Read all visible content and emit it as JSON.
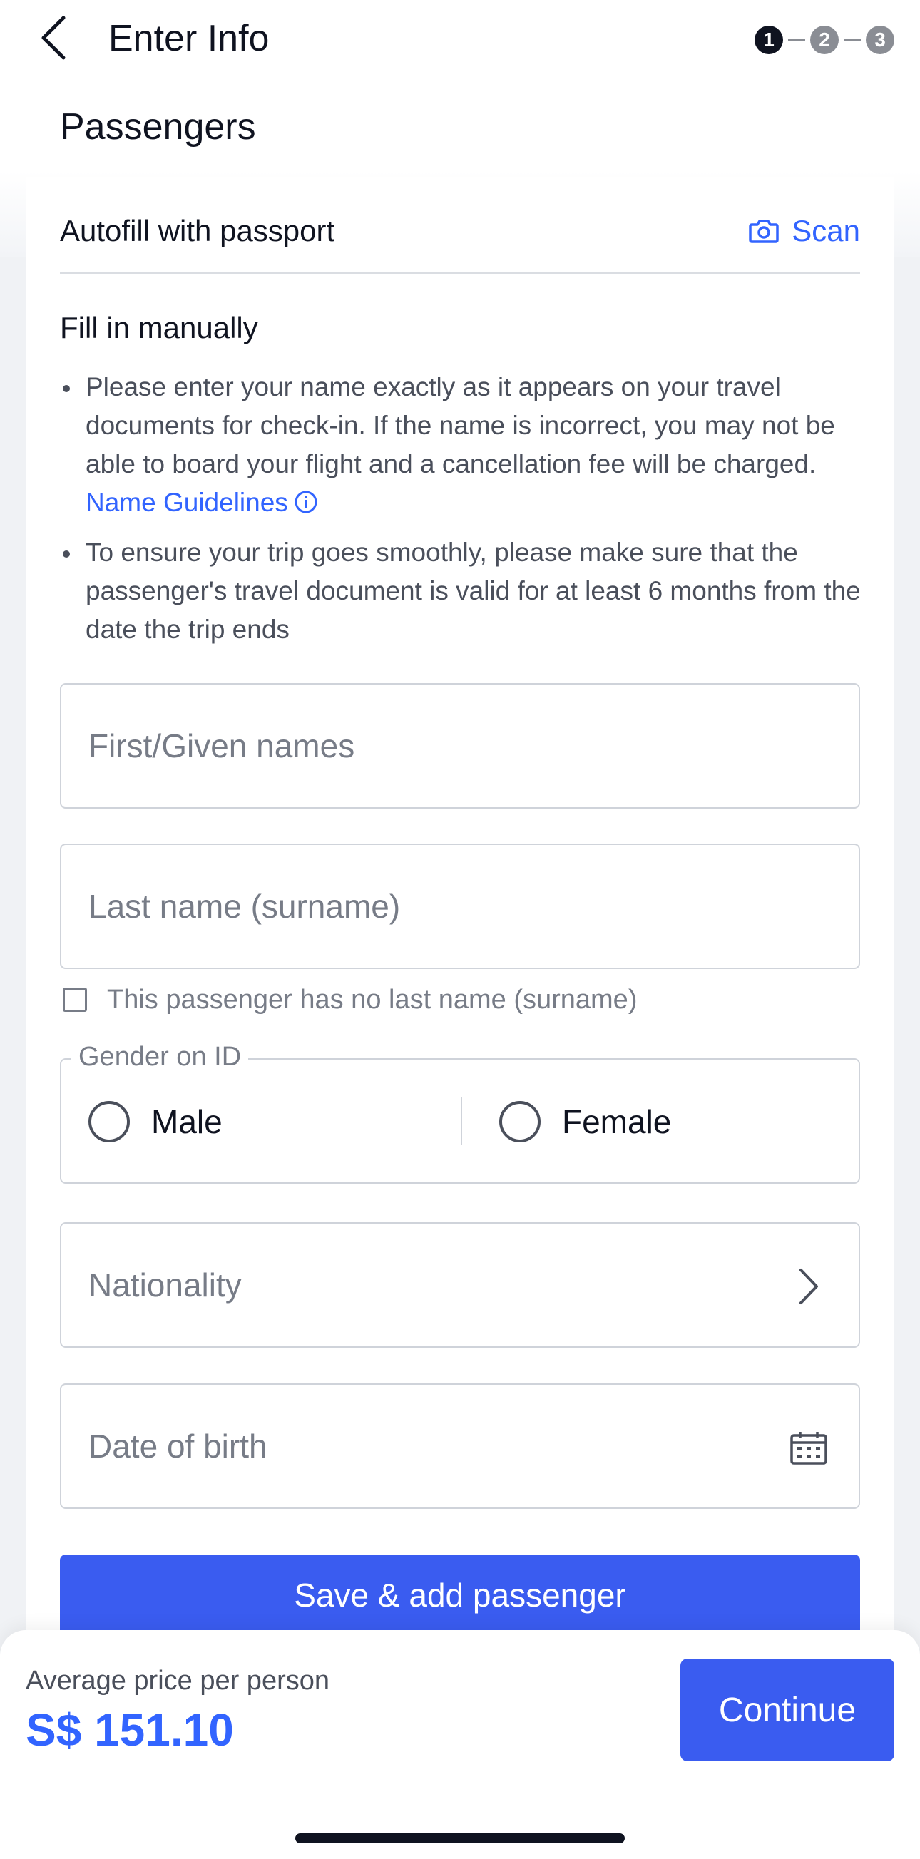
{
  "header": {
    "title": "Enter Info",
    "steps": [
      "1",
      "2",
      "3"
    ]
  },
  "section": {
    "title": "Passengers"
  },
  "autofill": {
    "label": "Autofill with passport",
    "scan_label": "Scan"
  },
  "manual": {
    "title": "Fill in manually",
    "note1_text": "Please enter your name exactly as it appears on your travel documents for check-in. If the name is incorrect, you may not be able to board your flight and a cancellation fee will be charged.",
    "note1_link": "Name Guidelines",
    "note2_text": "To ensure your trip goes smoothly, please make sure that the passenger's travel document is valid for at least 6 months from the date the trip ends"
  },
  "form": {
    "first_name_placeholder": "First/Given names",
    "last_name_placeholder": "Last name (surname)",
    "no_last_name_label": "This passenger has no last name (surname)",
    "gender_legend": "Gender on ID",
    "gender_male": "Male",
    "gender_female": "Female",
    "nationality_placeholder": "Nationality",
    "dob_placeholder": "Date of birth",
    "save_button": "Save & add passenger"
  },
  "footer": {
    "price_label": "Average price per person",
    "price_value": "S$ 151.10",
    "continue_button": "Continue"
  },
  "colors": {
    "accent": "#3a5cf0",
    "link": "#3264ff",
    "text_primary": "#0f1320",
    "text_muted": "#777c87"
  },
  "icons": {
    "back": "chevron-left-icon",
    "scan": "camera-icon",
    "info": "info-circle-icon",
    "nationality": "chevron-right-icon",
    "dob": "calendar-icon"
  }
}
